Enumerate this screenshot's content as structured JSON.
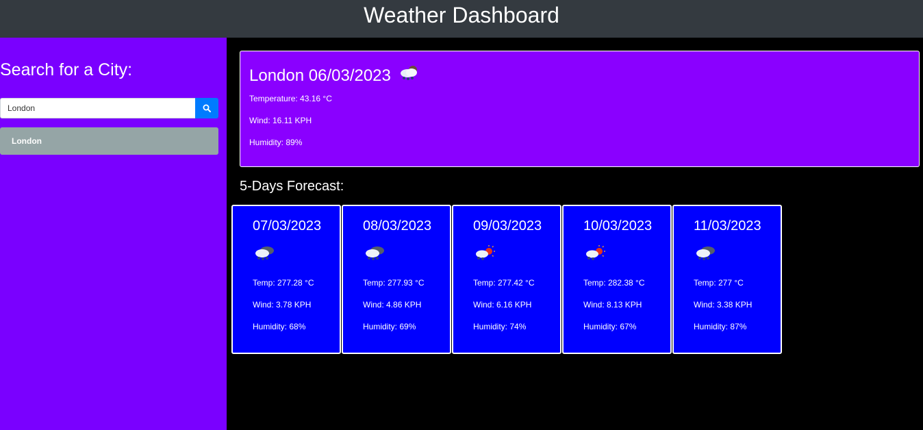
{
  "header": {
    "title": "Weather Dashboard"
  },
  "sidebar": {
    "heading": "Search for a City:",
    "search": {
      "value": "London",
      "icon": "search-icon"
    },
    "history": [
      {
        "label": "London"
      }
    ]
  },
  "current": {
    "title": "London 06/03/2023",
    "icon": "rain-cloud-icon",
    "temperature": "Temperature: 43.16 °C",
    "wind": "Wind: 16.11 KPH",
    "humidity": "Humidity: 89%"
  },
  "forecast": {
    "heading": "5-Days Forecast:",
    "days": [
      {
        "date": "07/03/2023",
        "icon": "snow-cloud-icon",
        "temp": "Temp: 277.28 °C",
        "wind": "Wind: 3.78 KPH",
        "humidity": "Humidity: 68%"
      },
      {
        "date": "08/03/2023",
        "icon": "snow-cloud-icon",
        "temp": "Temp: 277.93 °C",
        "wind": "Wind: 4.86 KPH",
        "humidity": "Humidity: 69%"
      },
      {
        "date": "09/03/2023",
        "icon": "snow-sun-icon",
        "temp": "Temp: 277.42 °C",
        "wind": "Wind: 6.16 KPH",
        "humidity": "Humidity: 74%"
      },
      {
        "date": "10/03/2023",
        "icon": "snow-sun-icon",
        "temp": "Temp: 282.38 °C",
        "wind": "Wind: 8.13 KPH",
        "humidity": "Humidity: 67%"
      },
      {
        "date": "11/03/2023",
        "icon": "snow-cloud-icon",
        "temp": "Temp: 277 °C",
        "wind": "Wind: 3.38 KPH",
        "humidity": "Humidity: 87%"
      }
    ]
  },
  "colors": {
    "header_bg": "#343a40",
    "sidebar_bg": "#7a00ff",
    "current_card_bg": "#8a00ff",
    "forecast_card_bg": "#0000ff",
    "search_button": "#007bff",
    "history_button": "#95a5a6",
    "page_bg": "#000000"
  }
}
